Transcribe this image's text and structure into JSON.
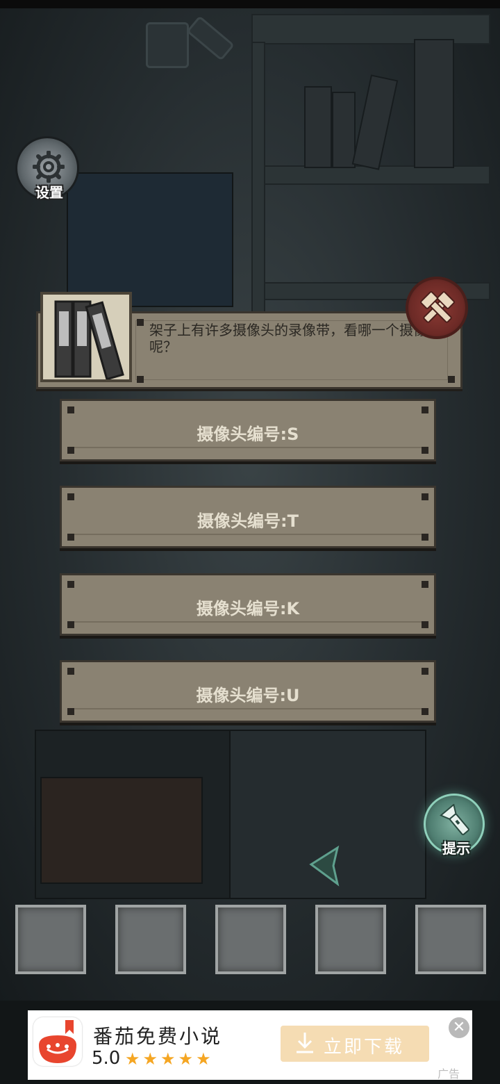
{
  "settings": {
    "label": "设置",
    "icon": "gear-icon"
  },
  "dialog": {
    "text": "架子上有许多摄像头的录像带，看哪一个摄像头呢？",
    "item_icon": "videotape-binders-icon",
    "close_icon": "crossed-tools-icon"
  },
  "options": [
    {
      "label": "摄像头编号:S"
    },
    {
      "label": "摄像头编号:T"
    },
    {
      "label": "摄像头编号:K"
    },
    {
      "label": "摄像头编号:U"
    }
  ],
  "hint": {
    "label": "提示",
    "icon": "flashlight-icon"
  },
  "navigation": {
    "back_icon": "back-arrow-icon"
  },
  "inventory": {
    "slot_count": 5
  },
  "ad": {
    "title": "番茄免费小说",
    "rating": "5.0",
    "stars": "★★★★★",
    "button": "立即下载",
    "close": "✕",
    "tag": "广告"
  },
  "colors": {
    "panel": "#8a8272",
    "option_text": "#e5dfcf",
    "close_red": "#8c3a34",
    "hint_teal": "#7fb0a0",
    "ad_button": "#f5dcb3",
    "star": "#f5a623"
  }
}
